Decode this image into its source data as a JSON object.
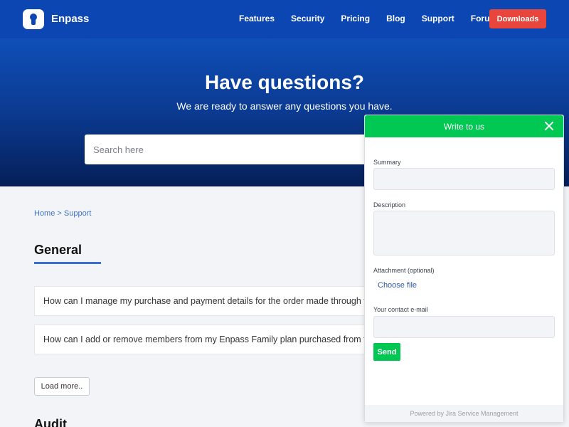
{
  "header": {
    "brand": "Enpass",
    "nav": [
      "Features",
      "Security",
      "Pricing",
      "Blog",
      "Support",
      "Forums"
    ],
    "cta": "Downloads",
    "colors": {
      "bar": "#0b46b3",
      "cta": "#e8453c"
    }
  },
  "hero": {
    "title": "Have questions?",
    "subtitle": "We are ready to answer any questions you have.",
    "search_placeholder": "Search here"
  },
  "content": {
    "breadcrumb": "Home > Support",
    "section_title": "General",
    "faqs": [
      "How can I manage my purchase and payment details for the order made through the",
      "How can I add or remove members from my Enpass Family plan purchased from the"
    ],
    "load_more": "Load more..",
    "next_section": "Audit"
  },
  "widget": {
    "title": "Write to us",
    "summary_label": "Summary",
    "description_label": "Description",
    "attachment_label": "Attachment (optional)",
    "choose_file": "Choose file",
    "email_label": "Your contact e-mail",
    "send": "Send",
    "footer": "Powered by Jira Service Management",
    "accent": "#00c853"
  }
}
